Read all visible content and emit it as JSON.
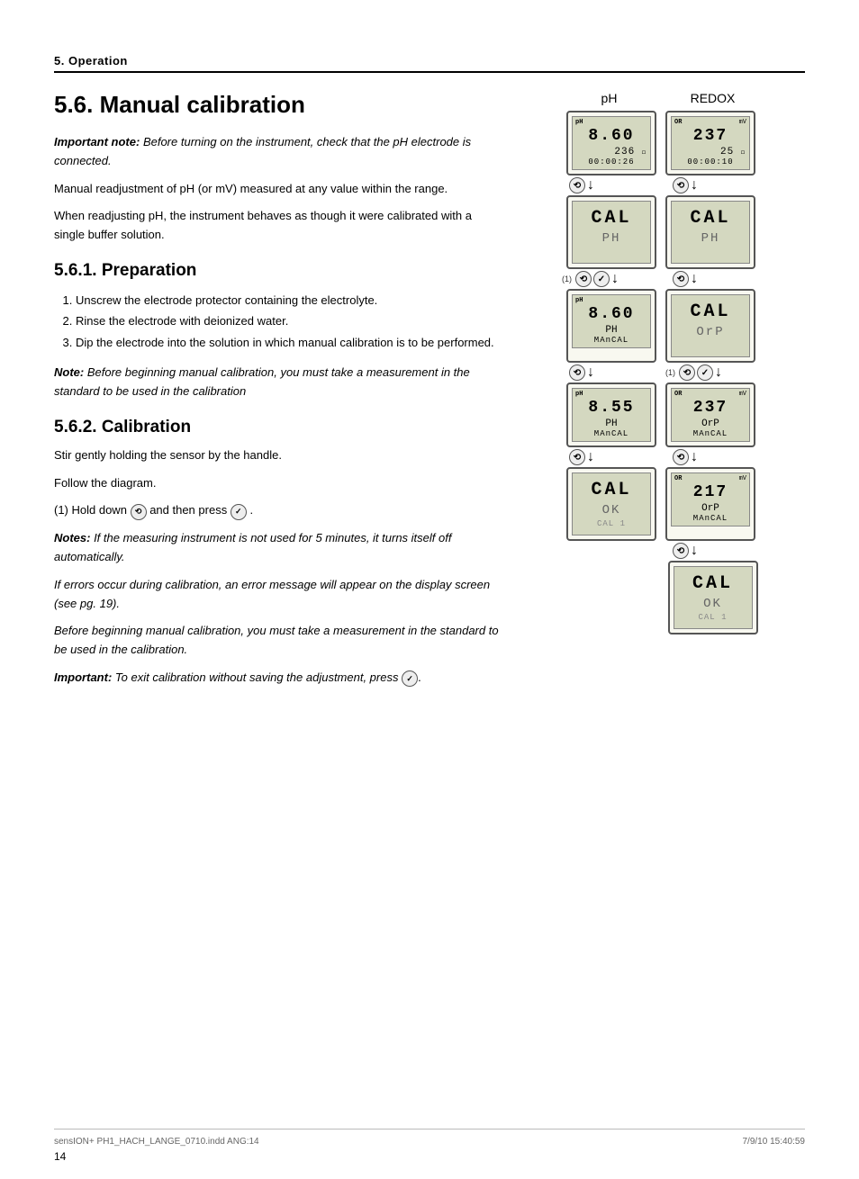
{
  "page": {
    "section_header": "5. Operation",
    "main_title": "5.6. Manual calibration",
    "important_note_label": "Important note:",
    "important_note_text": " Before turning on the instrument, check that the pH electrode is connected.",
    "para1": "Manual readjustment of pH (or mV) measured at any value within the range.",
    "para2": "When readjusting pH, the instrument behaves as though it were calibrated with a single buffer solution.",
    "sub1_title": "5.6.1. Preparation",
    "steps": [
      "Unscrew the electrode protector containing the electrolyte.",
      "Rinse the electrode with deionized water.",
      "Dip the electrode into the solution in which manual calibration is to be performed."
    ],
    "note_label": "Note:",
    "note_text": " Before beginning manual calibration, you must take a measurement in the standard to be used in the calibration",
    "sub2_title": "5.6.2. Calibration",
    "cal_para1": "Stir gently holding the sensor by the handle.",
    "cal_para2": "Follow the diagram.",
    "cal_instruction": "(1) Hold down",
    "cal_instruction2": "and then press",
    "notes_label": "Notes:",
    "notes_text": " If the measuring instrument is not used for 5 minutes, it turns itself off automatically.",
    "notes_text2": "If errors occur during calibration, an error message will appear on the display screen (see pg. 19).",
    "notes_text3": "Before beginning manual calibration, you must take a measurement in the standard to be used in the calibration.",
    "important_label": "Important:",
    "important_text": " To exit calibration without saving the adjustment, press",
    "page_number": "14",
    "footer_left": "sensION+ PH1_HACH_LANGE_0710.indd   ANG:14",
    "footer_right": "7/9/10   15:40:59",
    "diagrams": {
      "ph_label": "pH",
      "redox_label": "REDOX",
      "ph_col": [
        {
          "id": "ph1",
          "screen": {
            "main": "860",
            "sub": "236",
            "sub2": "00:00:26",
            "ph": "pH",
            "unit": ""
          },
          "buttons": "cal-arrow",
          "cal": "CAL",
          "line2": "PH",
          "line3": ""
        },
        {
          "id": "ph2",
          "screen": {
            "main": "860",
            "sub": "PH",
            "sub2": "MAnCAL",
            "ph": "pH",
            "unit": ""
          },
          "buttons": "cal-arrow",
          "cal": "CAL",
          "line2": "PH",
          "line3": "MAnCAL"
        },
        {
          "id": "ph3",
          "screen": {
            "main": "855",
            "sub": "PH",
            "sub2": "MAnCAL",
            "ph": "pH",
            "unit": ""
          },
          "buttons": "cal-arrow",
          "cal": "CAL",
          "line2": "OK",
          "line3": "CAL 1"
        }
      ],
      "redox_col": [
        {
          "id": "rx1",
          "screen": {
            "main": "237",
            "sub": "25",
            "sub2": "00:00:10",
            "ph": "OR",
            "unit": "mV"
          },
          "buttons": "cal-arrow",
          "cal": "CAL",
          "line2": "PH",
          "line3": ""
        },
        {
          "id": "rx2",
          "screen": {
            "main": "237",
            "sub": "OrP",
            "sub2": "MAnCAL",
            "ph": "OR",
            "unit": "mV"
          },
          "buttons": "cal-arrow",
          "cal": "CAL",
          "line2": "OrP",
          "line3": ""
        },
        {
          "id": "rx3",
          "screen": {
            "main": "217",
            "sub": "OrP",
            "sub2": "MAnCAL",
            "ph": "OR",
            "unit": "mV"
          },
          "buttons": "cal-arrow",
          "cal": "CAL",
          "line2": "OK",
          "line3": "CAL 1"
        }
      ]
    }
  }
}
